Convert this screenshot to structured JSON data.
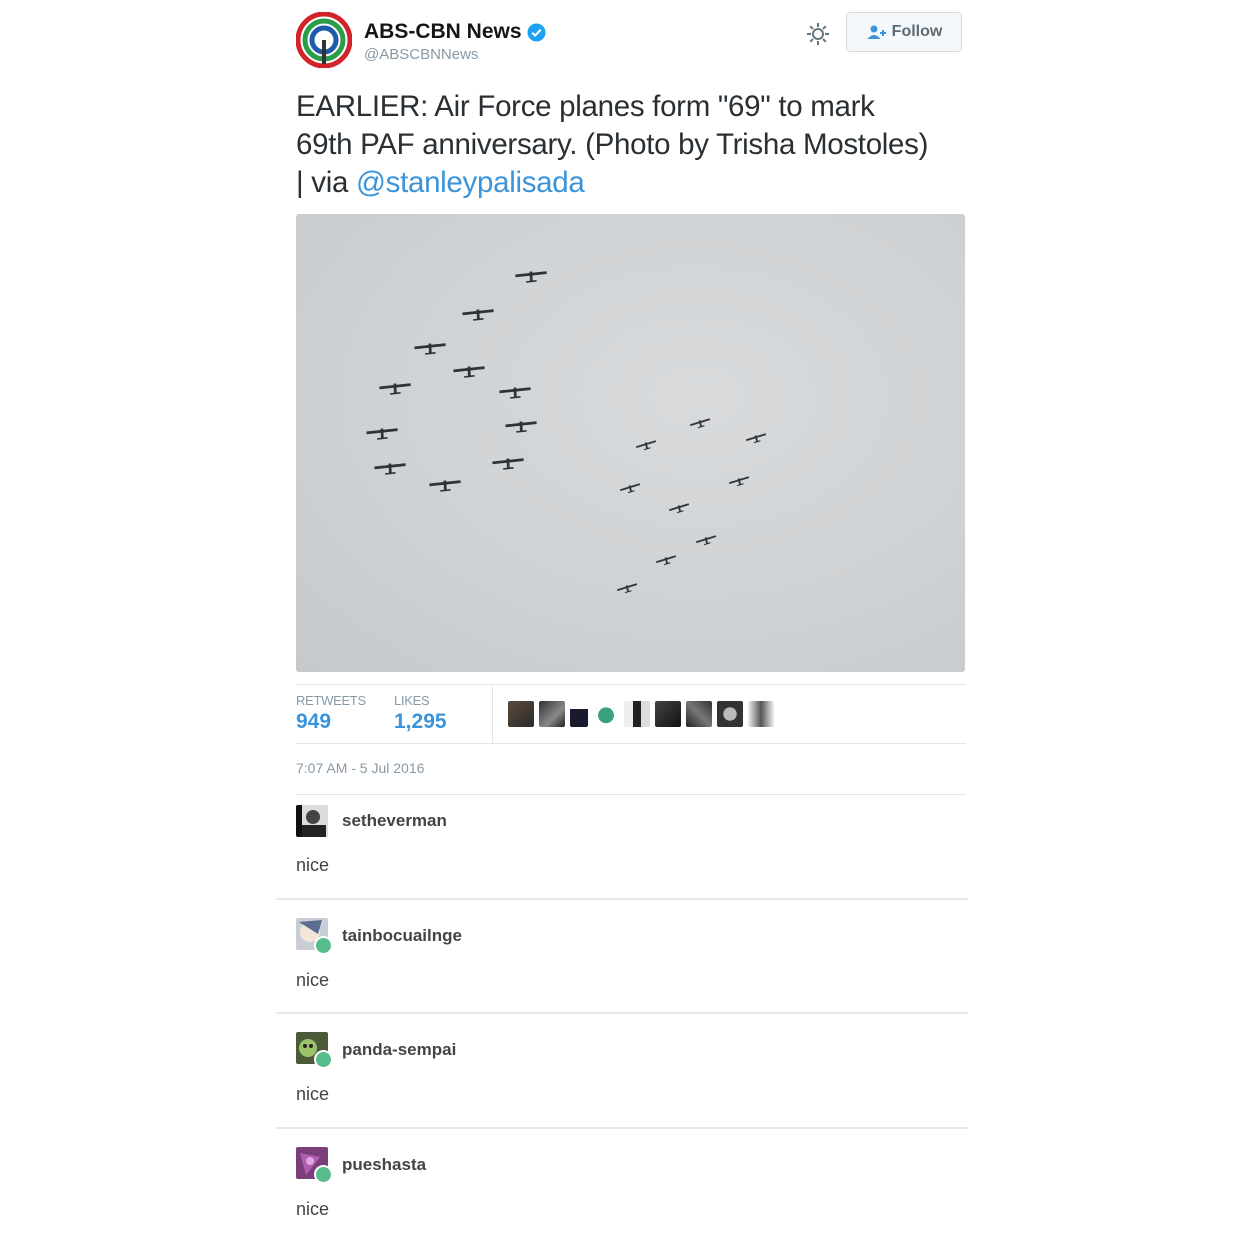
{
  "tweet": {
    "author_name": "ABS-CBN News",
    "author_handle": "@ABSCBNNews",
    "follow_label": "Follow",
    "text_parts": {
      "line1": "EARLIER: Air Force planes form \"69\" to mark",
      "line2": "69th PAF anniversary. (Photo by Trisha Mostoles)",
      "line3_prefix": "| via ",
      "mention": "@stanleypalisada"
    },
    "stats": {
      "retweets_label": "RETWEETS",
      "retweets_value": "949",
      "likes_label": "LIKES",
      "likes_value": "1,295"
    },
    "timestamp": "7:07 AM - 5 Jul 2016",
    "colors": {
      "link": "#3b94d9",
      "verified": "#1da1f2",
      "logo_red": "#d2232a",
      "logo_green": "#2a9d48",
      "logo_blue": "#1e5aa8"
    }
  },
  "notes": [
    {
      "username": "setheverman",
      "text": "nice",
      "avatar_icon": "user-photo-avatar"
    },
    {
      "username": "tainbocuailnge",
      "text": "nice",
      "avatar_icon": "anime-avatar"
    },
    {
      "username": "panda-sempai",
      "text": "nice",
      "avatar_icon": "green-face-avatar"
    },
    {
      "username": "pueshasta",
      "text": "nice",
      "avatar_icon": "purple-avatar"
    }
  ]
}
